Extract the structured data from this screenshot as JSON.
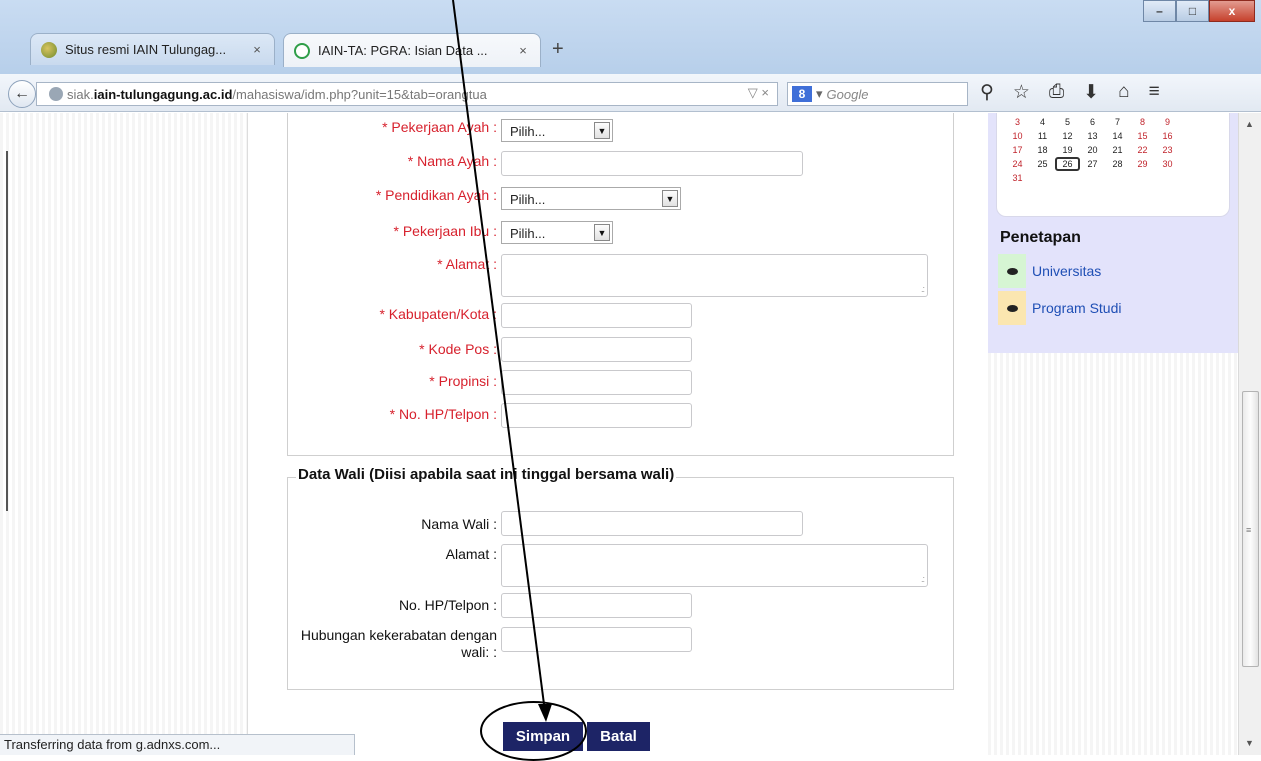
{
  "browser": {
    "tabs": [
      {
        "title": "Situs resmi IAIN Tulungag...",
        "close": "×"
      },
      {
        "title": "IAIN-TA: PGRA: Isian Data ...",
        "close": "×"
      }
    ],
    "new_tab": "+",
    "window_buttons": {
      "minimize": "–",
      "maximize": "□",
      "close": "x"
    },
    "url": {
      "host": "siak.",
      "domain": "iain-tulungagung.ac.id",
      "path": "/mahasiswa/idm.php?unit=15&tab=orangtua",
      "tools": "▽ ×"
    },
    "search": {
      "engine": "8",
      "engine_dropdown": "▾",
      "placeholder": "Google"
    },
    "toolbar_icons": [
      "search-icon",
      "star-icon",
      "reading-list-icon",
      "download-icon",
      "home-icon",
      "menu-icon"
    ],
    "toolbar_glyphs": [
      "⚲",
      "☆",
      "⎙",
      "⬇",
      "⌂",
      "≡"
    ],
    "back": "←"
  },
  "calendar": {
    "rows": [
      [
        "3",
        "4",
        "5",
        "6",
        "7",
        "8",
        "9"
      ],
      [
        "10",
        "11",
        "12",
        "13",
        "14",
        "15",
        "16"
      ],
      [
        "17",
        "18",
        "19",
        "20",
        "21",
        "22",
        "23"
      ],
      [
        "24",
        "25",
        "26",
        "27",
        "28",
        "29",
        "30"
      ],
      [
        "31",
        "",
        "",
        "",
        "",
        "",
        ""
      ]
    ],
    "today": "26",
    "weekend_color": "#c0232b"
  },
  "sidebar": {
    "title": "Penetapan",
    "links": [
      {
        "label": "Universitas",
        "color": "#d6f5d3"
      },
      {
        "label": "Program Studi",
        "color": "#fbe6b0"
      }
    ]
  },
  "form": {
    "parent": {
      "pekerjaan_ayah": {
        "label": "* Pekerjaan Ayah :",
        "value": "Pilih..."
      },
      "nama_ayah": {
        "label": "* Nama Ayah :"
      },
      "pendidikan_ayah": {
        "label": "* Pendidikan Ayah :",
        "value": "Pilih..."
      },
      "pekerjaan_ibu": {
        "label": "* Pekerjaan Ibu :",
        "value": "Pilih..."
      },
      "alamat": {
        "label": "* Alamat :"
      },
      "kabupaten": {
        "label": "* Kabupaten/Kota :"
      },
      "kode_pos": {
        "label": "* Kode Pos :"
      },
      "propinsi": {
        "label": "* Propinsi :"
      },
      "hp": {
        "label": "* No. HP/Telpon :"
      }
    },
    "wali": {
      "legend": "Data Wali (Diisi apabila saat ini tinggal bersama wali)",
      "nama_wali": {
        "label": "Nama Wali :"
      },
      "alamat": {
        "label": "Alamat :"
      },
      "hp": {
        "label": "No. HP/Telpon :"
      },
      "hubungan": {
        "label": "Hubungan kekerabatan dengan wali: :"
      }
    },
    "buttons": {
      "save": "Simpan",
      "cancel": "Batal"
    }
  },
  "status_bar": "Transferring data from g.adnxs.com...",
  "accent_colors": {
    "required_label": "#d7212d",
    "button": "#1d2466",
    "side_panel": "#e3e3fb",
    "link": "#1f4fb5"
  }
}
